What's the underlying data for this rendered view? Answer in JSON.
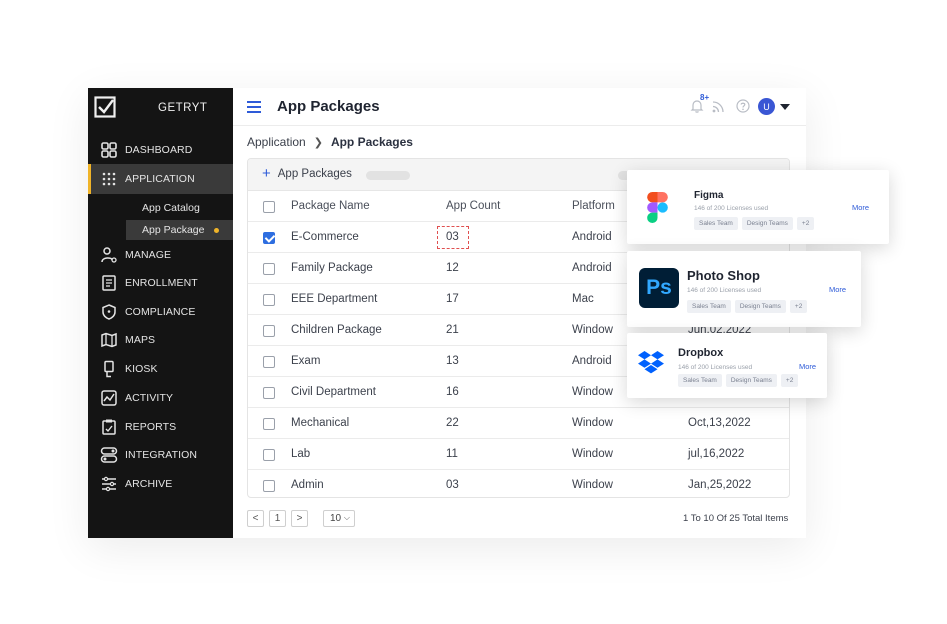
{
  "brand": {
    "name": "GETRYT"
  },
  "sidebar": {
    "items": [
      {
        "label": "DASHBOARD",
        "icon": "dashboard-icon"
      },
      {
        "label": "APPLICATION",
        "icon": "grid-icon"
      },
      {
        "label": "MANAGE",
        "icon": "user-gear-icon"
      },
      {
        "label": "ENROLLMENT",
        "icon": "enrollment-icon"
      },
      {
        "label": "COMPLIANCE",
        "icon": "shield-icon"
      },
      {
        "label": "MAPS",
        "icon": "map-icon"
      },
      {
        "label": "KIOSK",
        "icon": "kiosk-icon"
      },
      {
        "label": "ACTIVITY",
        "icon": "activity-icon"
      },
      {
        "label": "REPORTS",
        "icon": "reports-icon"
      },
      {
        "label": "INTEGRATION",
        "icon": "integration-icon"
      },
      {
        "label": "ARCHIVE",
        "icon": "archive-icon"
      }
    ],
    "sub_items": [
      {
        "label": "App Catalog"
      },
      {
        "label": "App Package"
      }
    ]
  },
  "header": {
    "title": "App Packages",
    "notification_badge": "8+",
    "avatar_letter": "U"
  },
  "breadcrumb": {
    "root": "Application",
    "current": "App Packages"
  },
  "card": {
    "add_label": "App Packages"
  },
  "table": {
    "columns": [
      "Package Name",
      "App Count",
      "Platform",
      ""
    ],
    "rows": [
      {
        "name": "E-Commerce",
        "count": "03",
        "platform": "Android",
        "date": "",
        "checked": true
      },
      {
        "name": "Family Package",
        "count": "12",
        "platform": "Android",
        "date": ""
      },
      {
        "name": "EEE Department",
        "count": "17",
        "platform": "Mac",
        "date": ""
      },
      {
        "name": "Children Package",
        "count": "21",
        "platform": "Window",
        "date": "Jun,02,2022"
      },
      {
        "name": "Exam",
        "count": "13",
        "platform": "Android",
        "date": ""
      },
      {
        "name": "Civil Department",
        "count": "16",
        "platform": "Window",
        "date": ""
      },
      {
        "name": "Mechanical",
        "count": "22",
        "platform": "Window",
        "date": "Oct,13,2022"
      },
      {
        "name": "Lab",
        "count": "11",
        "platform": "Window",
        "date": "jul,16,2022"
      },
      {
        "name": "Admin",
        "count": "03",
        "platform": "Window",
        "date": "Jan,25,2022"
      }
    ]
  },
  "pagination": {
    "prev": "<",
    "page": "1",
    "next": ">",
    "page_size": "10",
    "summary": "1 To 10  Of  25 Total Items"
  },
  "app_cards": [
    {
      "name": "Figma",
      "sub": "146 of 200 Licenses used",
      "tags": [
        "Sales Team",
        "Design Teams",
        "+2"
      ],
      "more": "More"
    },
    {
      "name": "Photo Shop",
      "sub": "146 of 200 Licenses used",
      "tags": [
        "Sales Team",
        "Design Teams",
        "+2"
      ],
      "more": "More",
      "logo_text": "Ps"
    },
    {
      "name": "Dropbox",
      "sub": "146 of 200 Licenses used",
      "tags": [
        "Sales Team",
        "Design Teams",
        "+2"
      ],
      "more": "More"
    }
  ],
  "colors": {
    "accent": "#2e5bd8",
    "sidebar_bg": "#141414",
    "active_marker": "#f0b429",
    "photoshop_bg": "#001e36",
    "photoshop_fg": "#31a8ff",
    "dropbox": "#0061fe"
  }
}
